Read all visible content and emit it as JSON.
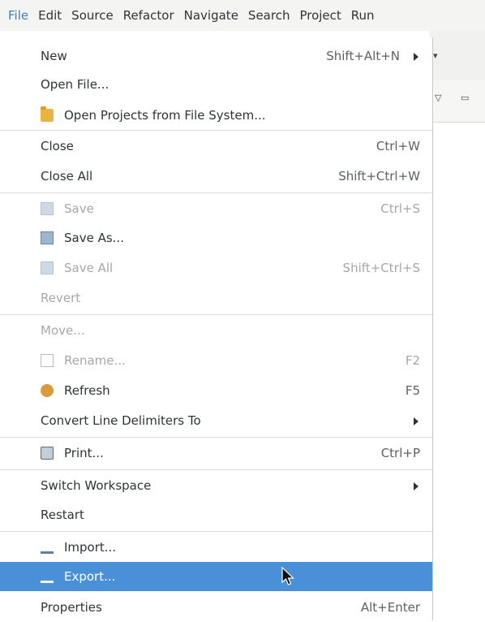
{
  "menubar": {
    "items": [
      {
        "label": "File",
        "active": true
      },
      {
        "label": "Edit"
      },
      {
        "label": "Source"
      },
      {
        "label": "Refactor"
      },
      {
        "label": "Navigate"
      },
      {
        "label": "Search"
      },
      {
        "label": "Project"
      },
      {
        "label": "Run"
      }
    ]
  },
  "file_menu": {
    "items": [
      {
        "label": "New",
        "accelerator": "Shift+Alt+N",
        "submenu": true
      },
      {
        "label": "Open File..."
      },
      {
        "label": "Open Projects from File System...",
        "icon": "folder-icon"
      },
      {
        "label": "Close",
        "accelerator": "Ctrl+W"
      },
      {
        "label": "Close All",
        "accelerator": "Shift+Ctrl+W"
      },
      {
        "label": "Save",
        "accelerator": "Ctrl+S",
        "icon": "save-icon",
        "disabled": true
      },
      {
        "label": "Save As...",
        "icon": "save-as-icon"
      },
      {
        "label": "Save All",
        "accelerator": "Shift+Ctrl+S",
        "icon": "save-all-icon",
        "disabled": true
      },
      {
        "label": "Revert",
        "disabled": true
      },
      {
        "label": "Move...",
        "disabled": true
      },
      {
        "label": "Rename...",
        "accelerator": "F2",
        "icon": "rename-icon",
        "disabled": true
      },
      {
        "label": "Refresh",
        "accelerator": "F5",
        "icon": "refresh-icon"
      },
      {
        "label": "Convert Line Delimiters To",
        "submenu": true
      },
      {
        "label": "Print...",
        "accelerator": "Ctrl+P",
        "icon": "print-icon"
      },
      {
        "label": "Switch Workspace",
        "submenu": true
      },
      {
        "label": "Restart"
      },
      {
        "label": "Import...",
        "icon": "import-icon"
      },
      {
        "label": "Export...",
        "icon": "export-icon",
        "selected": true
      },
      {
        "label": "Properties",
        "accelerator": "Alt+Enter"
      }
    ]
  },
  "colors": {
    "selection": "#4a90d9",
    "menubar_active": "#3d7fc8",
    "disabled_text": "#a5a7a8"
  }
}
